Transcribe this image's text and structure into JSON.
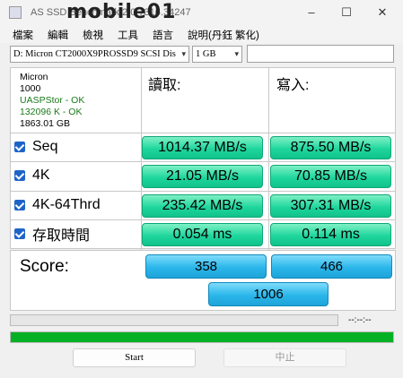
{
  "titlebar": {
    "title": "AS SSD Benchmark 2.0.7316.34247",
    "watermark": "mobile01",
    "min": "–",
    "max": "☐",
    "close": "✕"
  },
  "menu": [
    "檔案",
    "編輯",
    "檢視",
    "工具",
    "語言",
    "說明(丹鈺 繁化)"
  ],
  "toolbar": {
    "drive": "D: Micron CT2000X9PROSSD9 SCSI Dis",
    "size": "1 GB"
  },
  "info": {
    "brand": "Micron",
    "firmware": "1000",
    "driver_status": "UASPStor - OK",
    "alignment_status": "132096 K - OK",
    "capacity": "1863.01 GB"
  },
  "columns": {
    "read": "讀取:",
    "write": "寫入:"
  },
  "rows": [
    {
      "label": "Seq",
      "read": "1014.37 MB/s",
      "write": "875.50 MB/s"
    },
    {
      "label": "4K",
      "read": "21.05 MB/s",
      "write": "70.85 MB/s"
    },
    {
      "label": "4K-64Thrd",
      "read": "235.42 MB/s",
      "write": "307.31 MB/s"
    },
    {
      "label": "存取時間",
      "read": "0.054 ms",
      "write": "0.114 ms"
    }
  ],
  "score": {
    "label": "Score:",
    "read": "358",
    "write": "466",
    "total": "1006"
  },
  "progress": {
    "elapsed": "--:--:--",
    "overall_fraction": 1.0,
    "overall_color": "#06b025"
  },
  "buttons": {
    "start": "Start",
    "stop": "中止"
  }
}
